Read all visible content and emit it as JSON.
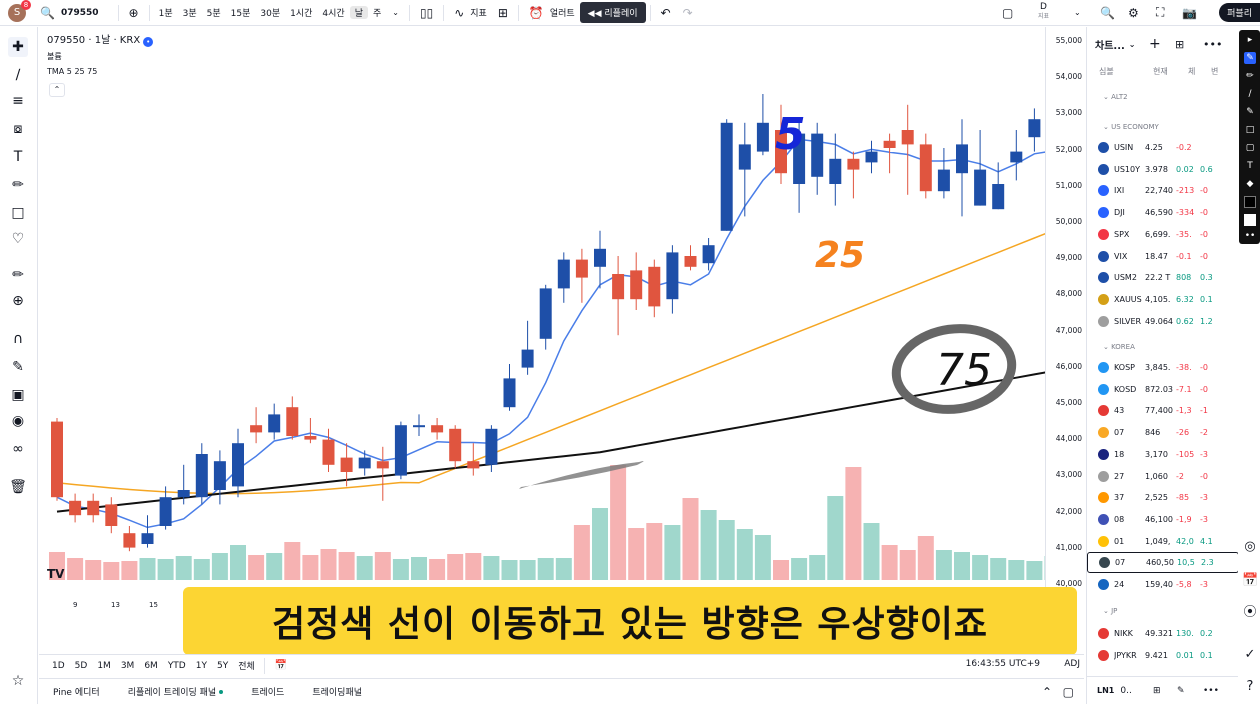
{
  "topbar": {
    "avatar_letter": "S",
    "avatar_badge": "8",
    "symbol": "079550",
    "intervals": [
      "1분",
      "3분",
      "5분",
      "15분",
      "30분",
      "1시간",
      "4시간",
      "날",
      "주"
    ],
    "active_interval": "날",
    "indicators_label": "지표",
    "alerts_label": "얼러트",
    "replay_label": "리플레이",
    "d_label": "D",
    "d_sub": "지표",
    "publish_label": "퍼블리"
  },
  "chart": {
    "title": "079550 · 1날 · KRX",
    "volume_label": "볼륨",
    "tma_label": "TMA 5 25 75",
    "price_ticks": [
      "55,000",
      "54,000",
      "53,000",
      "52,000",
      "51,000",
      "50,000",
      "49,000",
      "48,000",
      "47,000",
      "46,000",
      "45,000",
      "44,000",
      "43,000",
      "42,000",
      "41,000",
      "40,000"
    ],
    "date_ticks": [
      "9",
      "13",
      "15"
    ],
    "annotations": {
      "ma5": "5",
      "ma25": "25",
      "ma75": "75"
    },
    "logo": "TV"
  },
  "subtitle": "검정색 선이 이동하고 있는 방향은 우상향이죠",
  "period_bar": {
    "periods": [
      "1D",
      "5D",
      "1M",
      "3M",
      "6M",
      "YTD",
      "1Y",
      "5Y",
      "전체"
    ],
    "time": "16:43:55 UTC+9",
    "adj": "ADJ"
  },
  "bottom_tabs": [
    "Pine 에디터",
    "리플레이 트레이딩 패널",
    "트레이드",
    "트레이딩패널"
  ],
  "watchlist": {
    "title": "차트...",
    "cols": [
      "심볼",
      "현재",
      "체",
      "변"
    ],
    "sections": [
      "ALT2",
      "US ECONOMY",
      "KOREA",
      "JP"
    ],
    "rows_us": [
      {
        "sym": "USIN",
        "price": "4.25",
        "chg": "-0.2",
        "pct": "",
        "color": "#1e4fa8"
      },
      {
        "sym": "US10Y",
        "price": "3.978",
        "chg": "0.02",
        "pct": "0.6",
        "color": "#1e4fa8"
      },
      {
        "sym": "IXI",
        "price": "22,740",
        "chg": "-213",
        "pct": "-0",
        "color": "#2962ff"
      },
      {
        "sym": "DJI",
        "price": "46,590",
        "chg": "-334",
        "pct": "-0",
        "color": "#2962ff"
      },
      {
        "sym": "SPX",
        "price": "6,699.",
        "chg": "-35.",
        "pct": "-0",
        "color": "#f23645"
      },
      {
        "sym": "VIX",
        "price": "18.47",
        "chg": "-0.1",
        "pct": "-0",
        "color": "#1e4fa8"
      },
      {
        "sym": "USM2",
        "price": "22.2 T",
        "chg": "808",
        "pct": "0.3",
        "color": "#1e4fa8"
      },
      {
        "sym": "XAUUS",
        "price": "4,105.",
        "chg": "6.32",
        "pct": "0.1",
        "color": "#d4a017"
      },
      {
        "sym": "SILVER",
        "price": "49.064",
        "chg": "0.62",
        "pct": "1.2",
        "color": "#9e9e9e"
      }
    ],
    "rows_kr": [
      {
        "sym": "KOSP",
        "price": "3,845.",
        "chg": "-38.",
        "pct": "-0",
        "color": "#2196f3"
      },
      {
        "sym": "KOSD",
        "price": "872.03",
        "chg": "-7.1",
        "pct": "-0",
        "color": "#2196f3"
      },
      {
        "sym": "43",
        "price": "77,400",
        "chg": "-1,3",
        "pct": "-1",
        "color": "#e53935"
      },
      {
        "sym": "07",
        "price": "846",
        "chg": "-26",
        "pct": "-2",
        "color": "#f9a825"
      },
      {
        "sym": "18",
        "price": "3,170",
        "chg": "-105",
        "pct": "-3",
        "color": "#1a237e"
      },
      {
        "sym": "27",
        "price": "1,060",
        "chg": "-2",
        "pct": "-0",
        "color": "#9e9e9e"
      },
      {
        "sym": "37",
        "price": "2,525",
        "chg": "-85",
        "pct": "-3",
        "color": "#ff9800"
      },
      {
        "sym": "08",
        "price": "46,100",
        "chg": "-1,9",
        "pct": "-3",
        "color": "#3f51b5"
      },
      {
        "sym": "01",
        "price": "1,049,",
        "chg": "42,0",
        "pct": "4.1",
        "color": "#ffc107"
      },
      {
        "sym": "07",
        "price": "460,50",
        "chg": "10,5",
        "pct": "2.3",
        "color": "#37474f"
      },
      {
        "sym": "24",
        "price": "159,40",
        "chg": "-5,8",
        "pct": "-3",
        "color": "#1565c0"
      }
    ],
    "rows_jp": [
      {
        "sym": "NIKK",
        "price": "49.321",
        "chg": "130.",
        "pct": "0.2",
        "color": "#e53935"
      },
      {
        "sym": "JPYKR",
        "price": "9.421",
        "chg": "0.01",
        "pct": "0.1",
        "color": "#e53935"
      }
    ],
    "footer_label": "LN1",
    "footer_value": "0.."
  }
}
